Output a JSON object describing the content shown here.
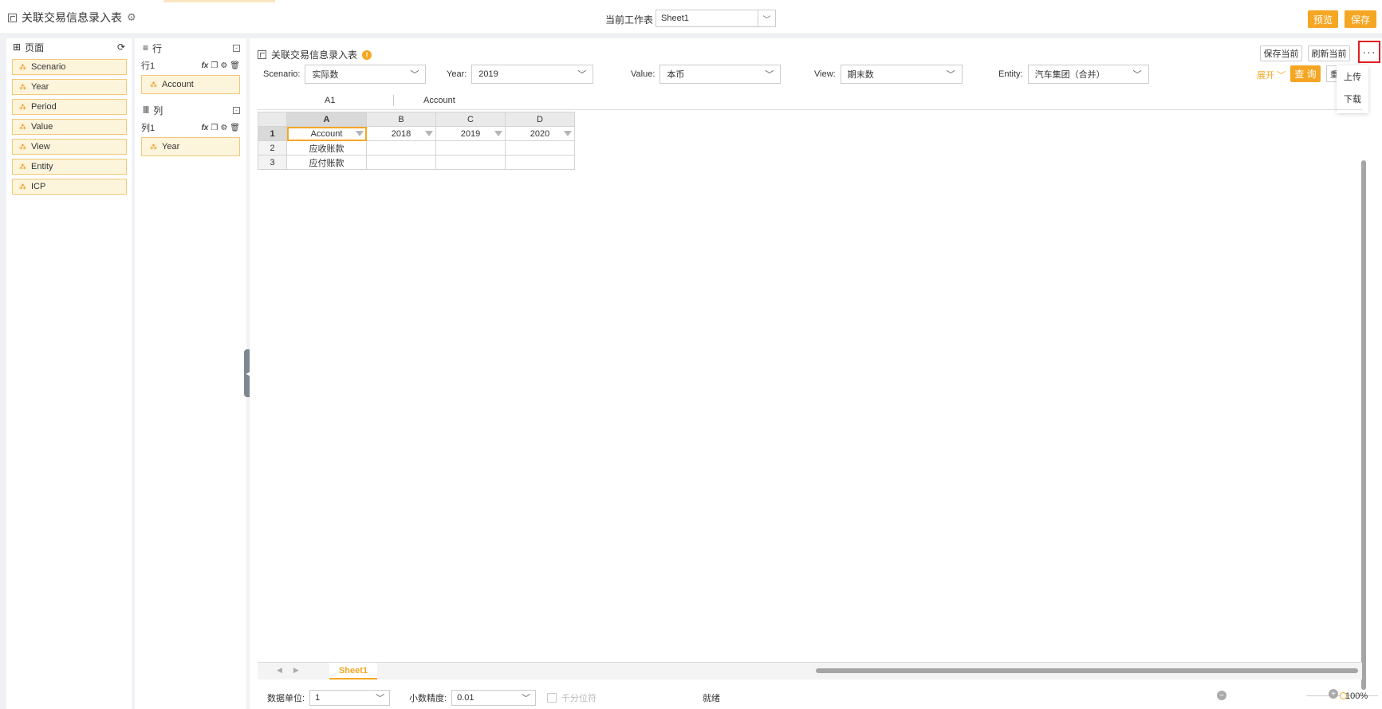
{
  "app": {
    "title": "关联交易信息录入表",
    "sheet_label": "当前工作表",
    "sheet_value": "Sheet1",
    "preview_label": "预览",
    "save_label": "保存"
  },
  "left_panel": {
    "title": "页面",
    "items": [
      "Scenario",
      "Year",
      "Period",
      "Value",
      "View",
      "Entity",
      "ICP"
    ]
  },
  "mid_panel": {
    "rows_title": "行",
    "row1_label": "行1",
    "row1_dim": "Account",
    "cols_title": "列",
    "col1_label": "列1",
    "col1_dim": "Year",
    "tools": "fx"
  },
  "form": {
    "title": "关联交易信息录入表",
    "save_current": "保存当前",
    "refresh_current": "刷新当前",
    "more": "···",
    "menu": [
      "上传",
      "下载"
    ],
    "expand_label": "展开",
    "query_label": "查 询"
  },
  "filters": [
    {
      "label": "Scenario:",
      "value": "实际数"
    },
    {
      "label": "Year:",
      "value": "2019"
    },
    {
      "label": "Value:",
      "value": "本币"
    },
    {
      "label": "View:",
      "value": "期末数"
    },
    {
      "label": "Entity:",
      "value": "汽车集团（合并）"
    }
  ],
  "formula_bar": {
    "cell_ref": "A1",
    "content": "Account"
  },
  "grid": {
    "columns": [
      "A",
      "B",
      "C",
      "D"
    ],
    "rows": [
      {
        "num": "1",
        "cells": [
          "Account",
          "2018",
          "2019",
          "2020"
        ]
      },
      {
        "num": "2",
        "cells": [
          "应收账款",
          "",
          "",
          ""
        ]
      },
      {
        "num": "3",
        "cells": [
          "应付账款",
          "",
          "",
          ""
        ]
      }
    ]
  },
  "tabs": {
    "active": "Sheet1"
  },
  "status": {
    "unit_label": "数据单位:",
    "unit_value": "1",
    "precision_label": "小数精度:",
    "precision_value": "0.01",
    "thousands_label": "千分位符",
    "state": "就绪",
    "zoom": "100%"
  },
  "colors": {
    "accent": "#f5a623",
    "highlight_border": "#e0201f"
  }
}
